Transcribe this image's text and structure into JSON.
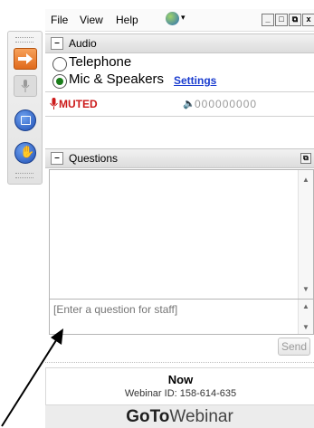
{
  "menubar": {
    "items": [
      "File",
      "View",
      "Help"
    ],
    "globe_caret": "▾",
    "window_buttons": [
      "_",
      "□",
      "⧉",
      "x"
    ]
  },
  "audio": {
    "section_title": "Audio",
    "options": [
      {
        "label": "Telephone",
        "selected": false
      },
      {
        "label": "Mic & Speakers",
        "selected": true
      }
    ],
    "settings_link": "Settings",
    "status_label": "MUTED",
    "volume_level": "000000000"
  },
  "questions": {
    "section_title": "Questions",
    "input_placeholder": "[Enter a question for staff]",
    "send_label": "Send"
  },
  "footer": {
    "status": "Now",
    "webinar_id": "Webinar ID: 158-614-635",
    "brand_bold": "GoTo",
    "brand_light": "Webinar"
  },
  "colors": {
    "muted_red": "#cc1a1a",
    "link_blue": "#1a3ccf",
    "raise_hand_orange": "#e06a1c",
    "control_blue": "#1f4fb4"
  }
}
